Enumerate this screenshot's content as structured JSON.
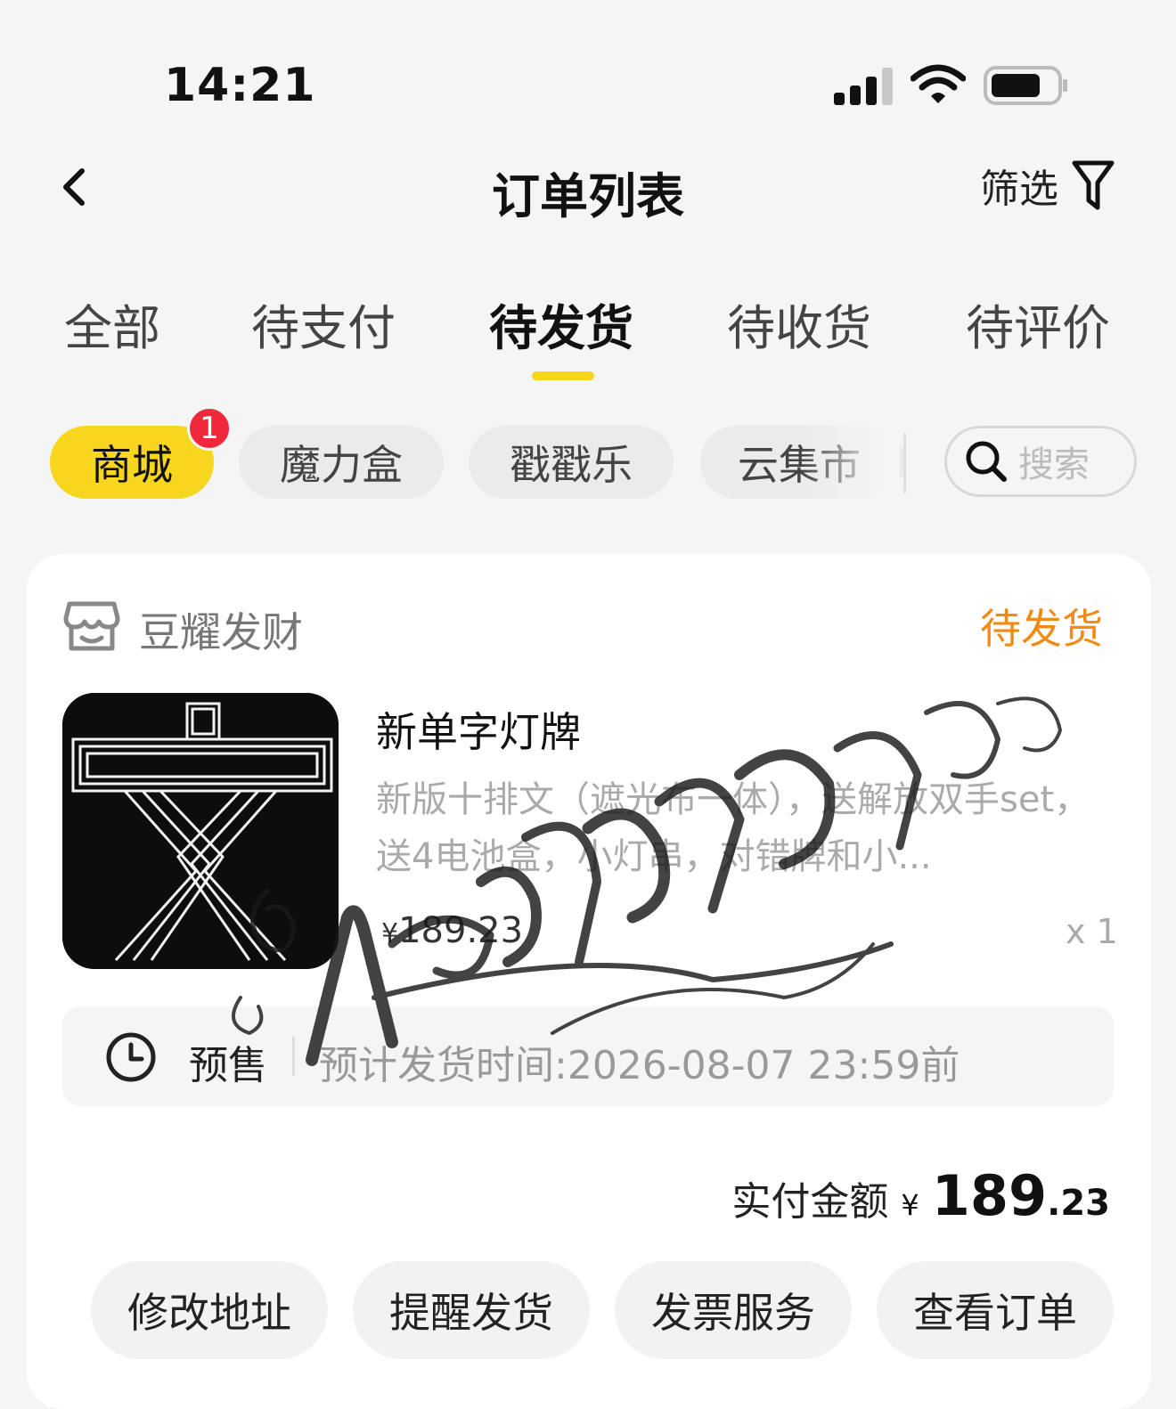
{
  "status_bar": {
    "time": "14:21"
  },
  "nav": {
    "title": "订单列表",
    "filter_label": "筛选"
  },
  "tabs": [
    {
      "label": "全部"
    },
    {
      "label": "待支付"
    },
    {
      "label": "待发货",
      "active": true
    },
    {
      "label": "待收货"
    },
    {
      "label": "待评价"
    }
  ],
  "categories": [
    {
      "label": "商城",
      "active": true,
      "badge": "1"
    },
    {
      "label": "魔力盒"
    },
    {
      "label": "戳戳乐"
    },
    {
      "label": "云集市"
    }
  ],
  "search": {
    "placeholder": "搜索"
  },
  "order": {
    "shop_name": "豆耀发财",
    "status": "待发货",
    "product": {
      "title": "新单字灯牌",
      "description": "新版十排文（遮光布一体），送解放双手set，送4电池盒，小灯串，对错牌和小...",
      "price_symbol": "¥",
      "price": "189.23",
      "quantity": "x 1",
      "thumbnail_glyph": "文"
    },
    "presale": {
      "label": "预售",
      "ship_time": "预计发货时间:2026-08-07 23:59前"
    },
    "paid": {
      "label": "实付金额",
      "symbol": "¥",
      "integer": "189",
      "decimal": ".23"
    },
    "actions": [
      "修改地址",
      "提醒发货",
      "发票服务",
      "查看订单"
    ]
  },
  "colors": {
    "accent": "#f8d61d",
    "status_orange": "#f28a14",
    "badge_red": "#f0283c"
  }
}
